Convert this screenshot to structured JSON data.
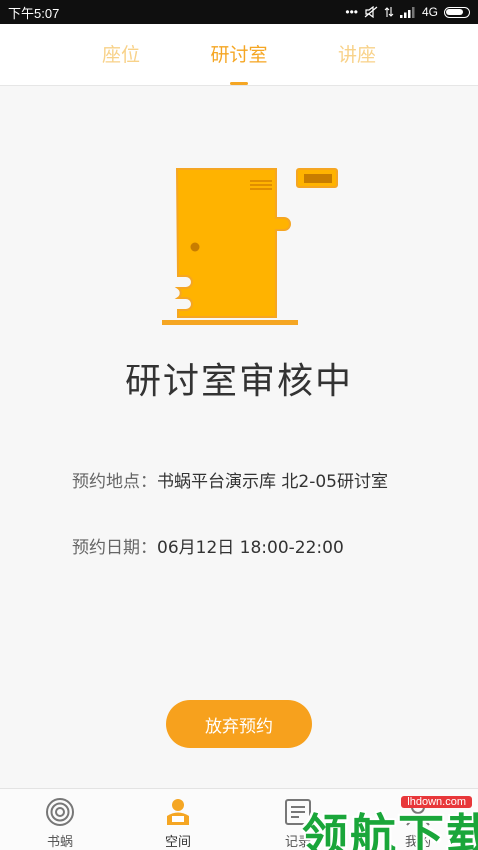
{
  "status_bar": {
    "time": "下午5:07",
    "icons": [
      "dots-icon",
      "mute-icon",
      "data-arrows-icon",
      "signal-icon"
    ],
    "network": "4G",
    "battery_level": 0.7
  },
  "tabs": [
    {
      "label": "座位",
      "active": false
    },
    {
      "label": "研讨室",
      "active": true
    },
    {
      "label": "讲座",
      "active": false
    }
  ],
  "illustration": "door-icon",
  "main": {
    "status_title": "研讨室审核中",
    "location_label": "预约地点：",
    "location_value": "书蜗平台演示库    北2-05研讨室",
    "date_label": "预约日期：",
    "date_value": "06月12日 18:00-22:00"
  },
  "cancel_button_label": "放弃预约",
  "bottom_nav": [
    {
      "label": "书蜗",
      "icon": "snail-icon",
      "active": false
    },
    {
      "label": "空间",
      "icon": "person-desk-icon",
      "active": true
    },
    {
      "label": "记录",
      "icon": "record-icon",
      "active": false
    },
    {
      "label": "我的",
      "icon": "user-icon",
      "active": false
    }
  ],
  "watermark": {
    "text": "领航下载",
    "site": "lhdown.com"
  },
  "colors": {
    "accent": "#f5a623",
    "accent_light": "#f8d28a",
    "door": "#ffb300",
    "button": "#f7a11d",
    "watermark_green": "#1aa63a"
  }
}
